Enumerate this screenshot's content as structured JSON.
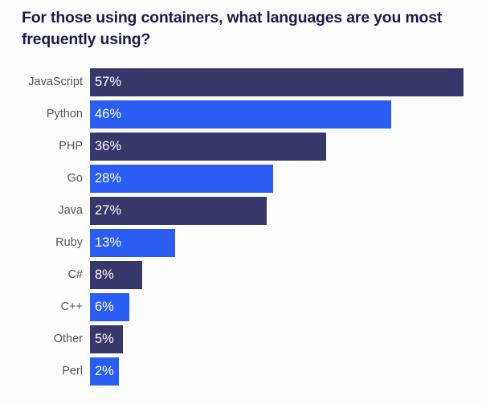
{
  "chart_data": {
    "type": "bar",
    "orientation": "horizontal",
    "title": "For those using containers, what languages are you most frequently using?",
    "xlabel": "",
    "ylabel": "",
    "xlim": [
      0,
      57
    ],
    "grid": false,
    "legend": "none",
    "value_suffix": "%",
    "categories": [
      "JavaScript",
      "Python",
      "PHP",
      "Go",
      "Java",
      "Ruby",
      "C#",
      "C++",
      "Other",
      "Perl"
    ],
    "values": [
      57,
      46,
      36,
      28,
      27,
      13,
      8,
      6,
      5,
      2
    ],
    "value_labels": [
      "57%",
      "46%",
      "36%",
      "28%",
      "27%",
      "13%",
      "8%",
      "6%",
      "5%",
      "2%"
    ],
    "bars": [
      {
        "category": "JavaScript",
        "value": 57,
        "label": "57%",
        "color": "#383769"
      },
      {
        "category": "Python",
        "value": 46,
        "label": "46%",
        "color": "#2b5df5"
      },
      {
        "category": "PHP",
        "value": 36,
        "label": "36%",
        "color": "#383769"
      },
      {
        "category": "Go",
        "value": 28,
        "label": "28%",
        "color": "#2b5df5"
      },
      {
        "category": "Java",
        "value": 27,
        "label": "27%",
        "color": "#383769"
      },
      {
        "category": "Ruby",
        "value": 13,
        "label": "13%",
        "color": "#2b5df5"
      },
      {
        "category": "C#",
        "value": 8,
        "label": "8%",
        "color": "#383769"
      },
      {
        "category": "C++",
        "value": 6,
        "label": "6%",
        "color": "#2b5df5"
      },
      {
        "category": "Other",
        "value": 5,
        "label": "5%",
        "color": "#383769"
      },
      {
        "category": "Perl",
        "value": 2,
        "label": "2%",
        "color": "#2b5df5"
      }
    ],
    "colors": {
      "navy": "#383769",
      "blue": "#2b5df5",
      "title_text": "#1b1b4b",
      "category_text": "#555558",
      "value_text": "#ffffff",
      "background": "#fdfdfd"
    }
  }
}
